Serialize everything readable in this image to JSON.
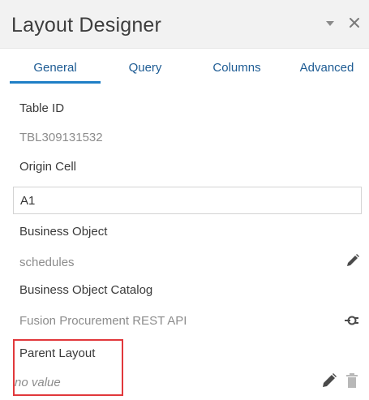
{
  "panel": {
    "title": "Layout Designer"
  },
  "tabs": [
    {
      "label": "General"
    },
    {
      "label": "Query"
    },
    {
      "label": "Columns"
    },
    {
      "label": "Advanced"
    }
  ],
  "active_tab": "General",
  "fields": {
    "table_id": {
      "label": "Table ID",
      "value": "TBL309131532"
    },
    "origin_cell": {
      "label": "Origin Cell",
      "value": "A1"
    },
    "business_object": {
      "label": "Business Object",
      "value": "schedules"
    },
    "business_object_catalog": {
      "label": "Business Object Catalog",
      "value": "Fusion Procurement REST API"
    },
    "parent_layout": {
      "label": "Parent Layout",
      "value": "no value"
    }
  },
  "colors": {
    "accent": "#1f7fc6",
    "tab_text": "#1d5b93",
    "highlight": "#e1383b",
    "header_bg": "#f2f2f2"
  },
  "icons": {
    "dropdown": "chevron-down-icon",
    "close": "close-icon",
    "edit": "pencil-icon",
    "catalog": "connection-icon",
    "delete": "trash-icon"
  }
}
